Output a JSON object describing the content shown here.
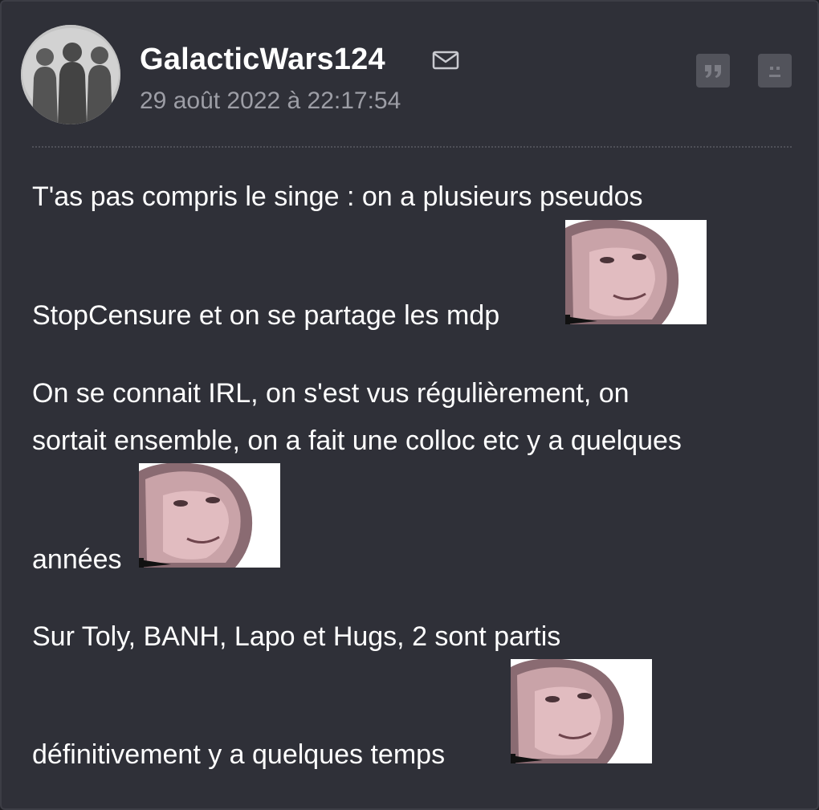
{
  "post": {
    "author": "GalacticWars124",
    "date": "29 août 2022 à 22:17:54",
    "icons": {
      "mail": "mail-icon",
      "quote": "quote-icon",
      "report": "sad-face-icon",
      "avatar": "silhouettes-avatar"
    },
    "lines": [
      "T'as pas compris le singe : on a plusieurs pseudos",
      "StopCensure et on se partage les mdp",
      "On se connait IRL, on s'est vus régulièrement, on",
      "sortait ensemble, on a fait une colloc etc y a quelques",
      "années",
      "Sur Toly, BANH, Lapo et Hugs, 2 sont partis",
      "définitivement y a quelques temps"
    ],
    "smiley_name": "palpatine-smiley"
  },
  "colors": {
    "background": "#2f3038",
    "text": "#ffffff",
    "date": "#9d9ea6",
    "button": "#52535b"
  }
}
